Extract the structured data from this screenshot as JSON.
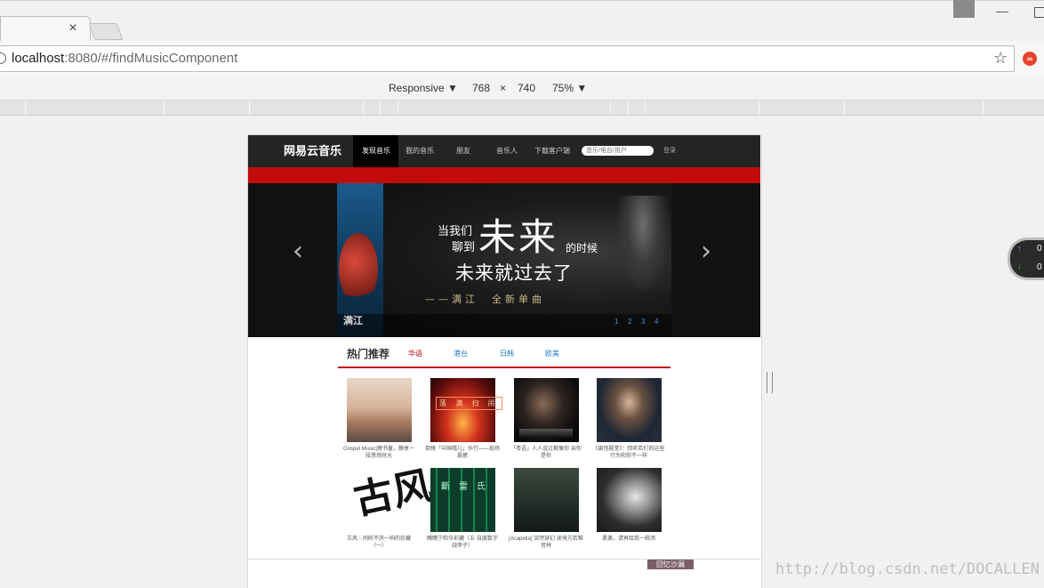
{
  "browser": {
    "tab_close_glyph": "×",
    "url_host": "localhost",
    "url_rest": ":8080/#/findMusicComponent",
    "star_glyph": "☆",
    "window_min_glyph": "—"
  },
  "devtools": {
    "device": "Responsive",
    "width": "768",
    "times": "×",
    "height": "740",
    "zoom": "75%",
    "caret": "▼"
  },
  "site": {
    "logo": "网易云音乐",
    "nav": [
      "发现音乐",
      "我的音乐",
      "朋友",
      "音乐人",
      "下载客户端"
    ],
    "search_placeholder": "音乐/电台/用户",
    "login": "登录"
  },
  "banner": {
    "line1a": "当我们",
    "line1b": "聊到",
    "big": "未来",
    "line1c": "的时候",
    "line2": "未来就过去了",
    "line3": "——满江　全新单曲",
    "artist": "满江",
    "dots": [
      "1",
      "2",
      "3",
      "4"
    ],
    "prev": "‹",
    "next": "›"
  },
  "hot": {
    "title": "热门推荐",
    "tabs": [
      "华语",
      "港台",
      "日韩",
      "欧美"
    ],
    "items": [
      {
        "caption": "Gospel Music|撩书童，静享一段悠然时光"
      },
      {
        "caption": "目睹「中国嘻儿」乐行——现场震撼"
      },
      {
        "caption": "「粤语」人人说过都像你 自你是你"
      },
      {
        "caption": "《离怪殿堂》：但听若们的这些行为和你不一样"
      },
      {
        "caption": "古风｜同听不厌一响的珍藏（一）"
      },
      {
        "caption": "瞧瞧宁和华彩藏（五 自度数字战李子）"
      },
      {
        "caption": "[Acapella] 突然穿幻 途境方若稚音林"
      },
      {
        "caption": "柔婆，请再给我一碗汤"
      }
    ],
    "c2_title": "落 满 扫 闹",
    "c5_art": "古风",
    "c6_title": "斷 雷 氏"
  },
  "footer": {
    "qr": "回忆沙漏"
  },
  "net_widget": {
    "up_icon": "↑",
    "down_icon": "↓",
    "up_value": "0",
    "down_value": "0"
  },
  "watermark": "http://blog.csdn.net/DOCALLEN",
  "colors": {
    "brand_red": "#c20c0c",
    "header_dark": "#242424",
    "link_blue": "#1e78c8"
  }
}
